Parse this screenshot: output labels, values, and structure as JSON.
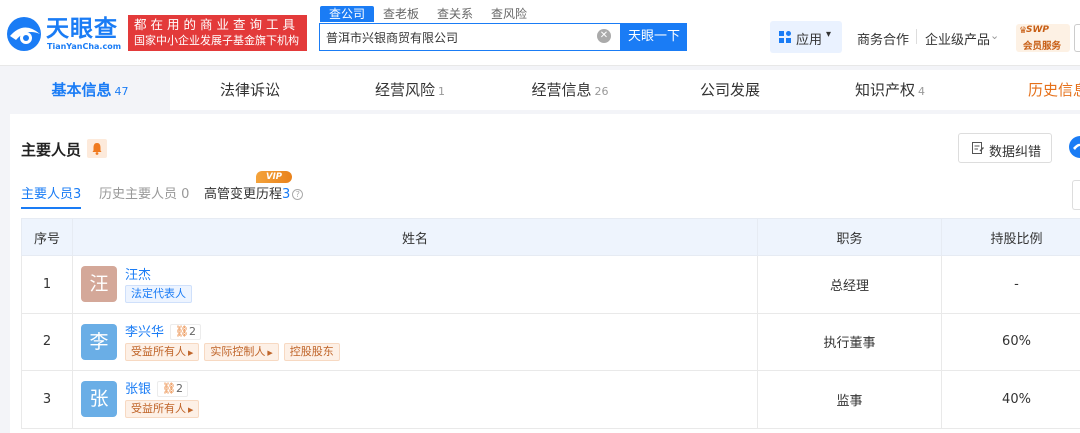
{
  "logo": {
    "cn": "天眼查",
    "en": "TianYanCha.com"
  },
  "promo": {
    "line1": "都在用的商业查询工具",
    "line2": "国家中小企业发展子基金旗下机构"
  },
  "search": {
    "tabs": [
      "查公司",
      "查老板",
      "查关系",
      "查风险"
    ],
    "value": "普洱市兴银商贸有限公司",
    "button": "天眼一下"
  },
  "nav": {
    "apps": "应用",
    "apps_caret": "▾",
    "biz": "商务合作",
    "enterprise": "企业级产品",
    "enterprise_caret": "⌄"
  },
  "member": {
    "line1": "SWP",
    "line2": "会员服务"
  },
  "main_tabs": [
    {
      "label": "基本信息",
      "count": "47"
    },
    {
      "label": "法律诉讼",
      "count": ""
    },
    {
      "label": "经营风险",
      "count": "1"
    },
    {
      "label": "经营信息",
      "count": "26"
    },
    {
      "label": "公司发展",
      "count": ""
    },
    {
      "label": "知识产权",
      "count": "4"
    },
    {
      "label": "历史信息",
      "count": ""
    }
  ],
  "section": {
    "title": "主要人员",
    "correction": "数据纠错",
    "subtabs": [
      {
        "label": "主要人员",
        "count": "3"
      },
      {
        "label": "历史主要人员",
        "count": "0"
      },
      {
        "label": "高管变更历程",
        "count": "3"
      }
    ],
    "vip_badge": "VIP"
  },
  "table": {
    "headers": [
      "序号",
      "姓名",
      "职务",
      "持股比例"
    ],
    "rows": [
      {
        "index": "1",
        "avatar": "汪",
        "avatar_color": "#d4a899",
        "name": "汪杰",
        "relations": "",
        "tags": [
          "法定代表人"
        ],
        "position": "总经理",
        "share": "-"
      },
      {
        "index": "2",
        "avatar": "李",
        "avatar_color": "#6aaee6",
        "name": "李兴华",
        "relations": "2",
        "tags": [
          "受益所有人",
          "实际控制人",
          "控股股东"
        ],
        "position": "执行董事",
        "share": "60%"
      },
      {
        "index": "3",
        "avatar": "张",
        "avatar_color": "#6aaee6",
        "name": "张银",
        "relations": "2",
        "tags": [
          "受益所有人"
        ],
        "position": "监事",
        "share": "40%"
      }
    ]
  },
  "colors": {
    "accent": "#1a7cf5",
    "promo_red": "#e33a3a",
    "history_tab": "#e5701a"
  }
}
